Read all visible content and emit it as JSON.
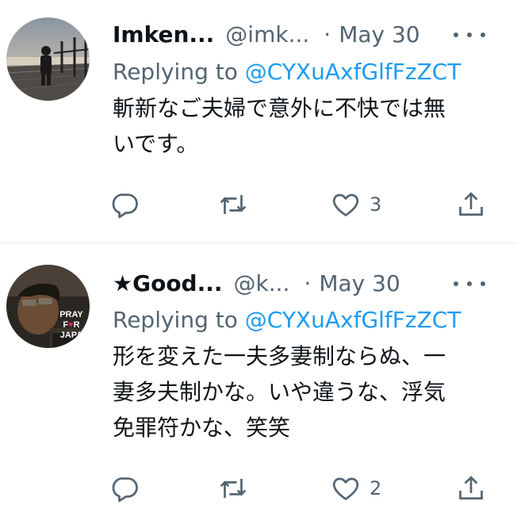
{
  "tweets": [
    {
      "name": "Imken...",
      "handle": "@imk...",
      "separator": "·",
      "time": "May 30",
      "replying_prefix": "Replying to ",
      "replying_to": "@CYXuAxfGlfFzZCT",
      "text_lines": [
        "斬新なご夫婦で意外に不快では無",
        "いです。"
      ],
      "likes": "3",
      "avatar": "photo-person-on-pier"
    },
    {
      "name": "★Good...",
      "handle": "@k...",
      "separator": "·",
      "time": "May 30",
      "replying_prefix": "Replying to ",
      "replying_to": "@CYXuAxfGlfFzZCT",
      "text_lines": [
        "形を変えた一夫多妻制ならぬ、一",
        "妻多夫制かな。いや違うな、浮気",
        "免罪符かな、笑笑"
      ],
      "likes": "2",
      "avatar": "photo-man-pray-for-japan",
      "avatar_text": [
        "PRAY",
        "F",
        "R",
        "JAPA"
      ]
    }
  ],
  "icons": {
    "reply": "reply-icon",
    "retweet": "retweet-icon",
    "like": "heart-icon",
    "share": "share-icon",
    "more": "more-icon"
  },
  "colors": {
    "link": "#1d9bf0",
    "secondary": "#536471",
    "text": "#0f1419",
    "divider": "#e6ecf0"
  }
}
